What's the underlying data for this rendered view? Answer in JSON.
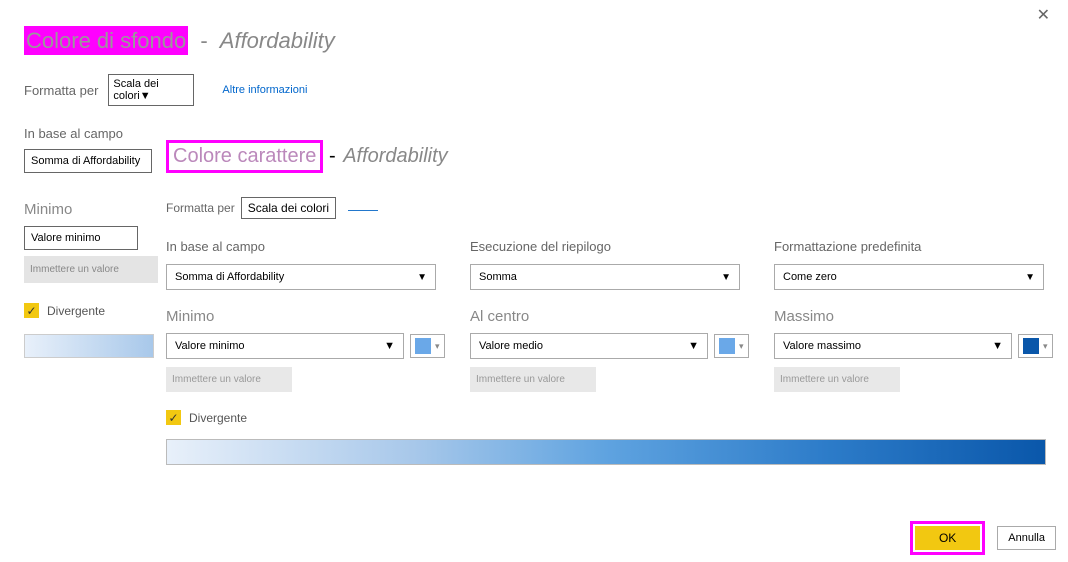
{
  "close_icon": "✕",
  "back": {
    "title1": "Colore di sfondo",
    "sep": " - ",
    "title2": "Affordability",
    "format_label": "Formatta per",
    "format_value": "Scala dei colori",
    "more_info": "Altre informazioni",
    "field_label": "In base al campo",
    "field_value": "Somma di Affordability",
    "min_label": "Minimo",
    "min_value": "Valore minimo",
    "min_placeholder": "Immettere un valore",
    "diverging_label": "Divergente",
    "check_glyph": "✓"
  },
  "front": {
    "title1": "Colore carattere",
    "title2": "Affordability",
    "format_label": "Formatta per",
    "format_value": "Scala dei colori",
    "cols": [
      {
        "label": "In base al campo",
        "value": "Somma di Affordability"
      },
      {
        "label": "Esecuzione del riepilogo",
        "value": "Somma"
      },
      {
        "label": "Formattazione predefinita",
        "value": "Come zero"
      }
    ],
    "sec": [
      {
        "label": "Minimo",
        "value": "Valore minimo",
        "color": "#6aa8e8",
        "placeholder": "Immettere un valore"
      },
      {
        "label": "Al centro",
        "value": "Valore medio",
        "color": "#6aa8e8",
        "placeholder": "Immettere un valore"
      },
      {
        "label": "Massimo",
        "value": "Valore massimo",
        "color": "#0a57aa",
        "placeholder": "Immettere un valore"
      }
    ],
    "diverging_label": "Divergente",
    "check_glyph": "✓",
    "arrow": "▼",
    "ok": "OK",
    "cancel": "Annulla"
  }
}
